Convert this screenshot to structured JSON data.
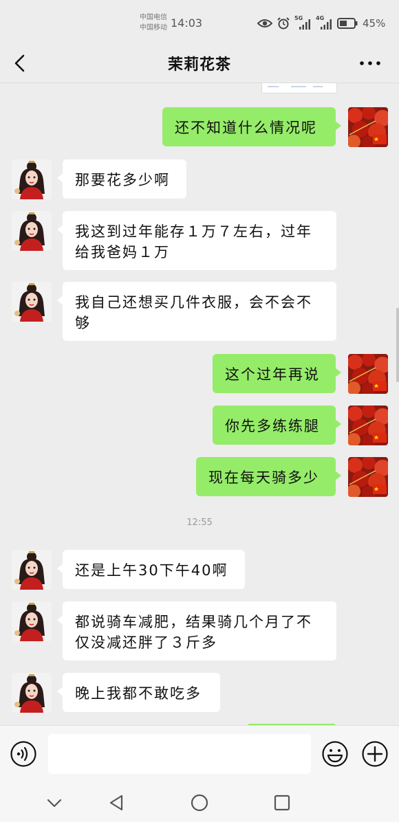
{
  "status_bar": {
    "carrier_1": "中国电信",
    "carrier_2": "中国移动",
    "time": "14:03",
    "net_1": "5G",
    "net_2": "4G",
    "battery": "45%",
    "icons": [
      "eye-icon",
      "alarm-icon",
      "signal-5g-icon",
      "signal-4g-icon",
      "battery-icon"
    ]
  },
  "header": {
    "title": "茉莉花茶",
    "back_icon": "back-arrow-icon",
    "more_icon": "more-icon"
  },
  "timestamp": "12:55",
  "messages": [
    {
      "side": "out",
      "text": "还不知道什么情况呢"
    },
    {
      "side": "in",
      "text": "那要花多少啊"
    },
    {
      "side": "in",
      "text": "我这到过年能存１万７左右，过年给我爸妈１万"
    },
    {
      "side": "in",
      "text": "我自己还想买几件衣服，会不会不够"
    },
    {
      "side": "out",
      "text": "这个过年再说"
    },
    {
      "side": "out",
      "text": "你先多练练腿"
    },
    {
      "side": "out",
      "text": "现在每天骑多少"
    },
    {
      "side": "in",
      "text": "还是上午30下午40啊"
    },
    {
      "side": "in",
      "text": "都说骑车减肥，结果骑几个月了不仅没减还胖了３斤多"
    },
    {
      "side": "in",
      "text": "晚上我都不敢吃多"
    }
  ],
  "input_bar": {
    "voice_icon": "voice-icon",
    "input_value": "",
    "emoji_icon": "emoji-icon",
    "plus_icon": "plus-icon"
  },
  "nav_bar": {
    "icons": [
      "hide-keyboard-icon",
      "nav-back-icon",
      "nav-home-icon",
      "nav-recents-icon"
    ]
  },
  "colors": {
    "background": "#ededed",
    "outgoing_bubble": "#95ec69",
    "incoming_bubble": "#ffffff",
    "text": "#111111"
  }
}
